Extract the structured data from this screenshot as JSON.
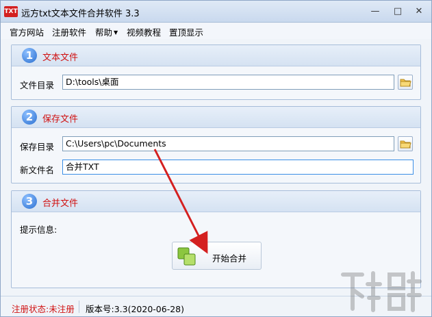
{
  "window": {
    "title": "远方txt文本文件合并软件 3.3",
    "icon_text": "TXT"
  },
  "menu": [
    {
      "label": "官方网站",
      "has_dropdown": false
    },
    {
      "label": "注册软件",
      "has_dropdown": false
    },
    {
      "label": "帮助",
      "has_dropdown": true
    },
    {
      "label": "视频教程",
      "has_dropdown": false
    },
    {
      "label": "置顶显示",
      "has_dropdown": false
    }
  ],
  "sections": {
    "text_files": {
      "number": "1",
      "title": "文本文件",
      "dir_label": "文件目录",
      "dir_value": "D:\\tools\\桌面"
    },
    "save_file": {
      "number": "2",
      "title": "保存文件",
      "dir_label": "保存目录",
      "dir_value": "C:\\Users\\pc\\Documents",
      "name_label": "新文件名",
      "name_value": "合并TXT"
    },
    "merge": {
      "number": "3",
      "title": "合并文件",
      "info_label": "提示信息:",
      "button_label": "开始合并"
    }
  },
  "status": {
    "registration": "注册状态:未注册",
    "version": "版本号:3.3(2020-06-28)"
  },
  "colors": {
    "accent_red": "#d01010",
    "accent_blue": "#2a6fd0",
    "arrow": "#d42020"
  },
  "icons": [
    "app-icon",
    "minimize-icon",
    "maximize-icon",
    "close-icon",
    "folder-icon",
    "merge-icon",
    "dropdown-arrow-icon"
  ]
}
